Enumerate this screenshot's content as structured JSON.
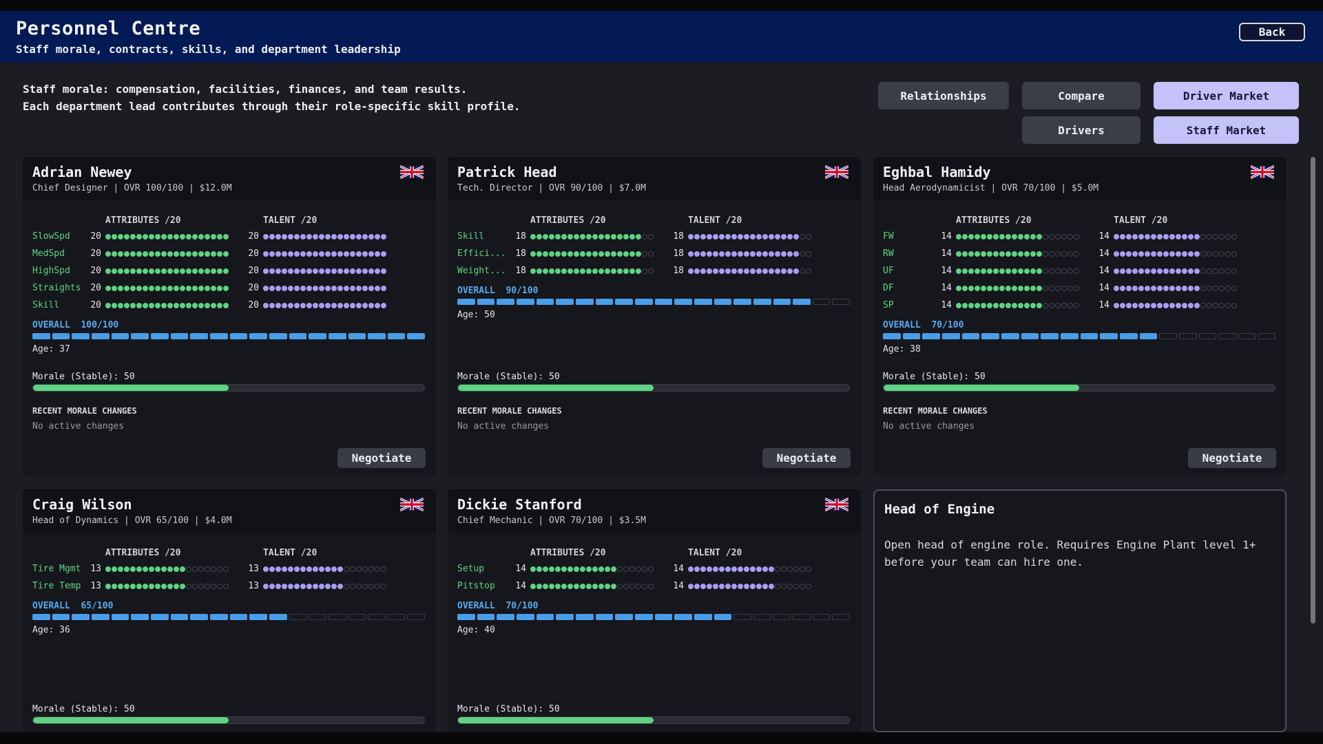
{
  "header": {
    "title": "Personnel Centre",
    "subtitle": "Staff morale, contracts, skills, and department leadership",
    "back_label": "Back"
  },
  "intro": {
    "line1": "Staff morale: compensation, facilities, finances, and team results.",
    "line2": "Each department lead contributes through their role-specific skill profile."
  },
  "nav": {
    "relationships": "Relationships",
    "compare": "Compare",
    "driver_market": "Driver Market",
    "drivers": "Drivers",
    "staff_market": "Staff Market"
  },
  "labels": {
    "attributes": "ATTRIBUTES /20",
    "talent": "TALENT /20",
    "overall": "OVERALL",
    "recent": "RECENT MORALE CHANGES",
    "no_changes": "No active changes",
    "negotiate": "Negotiate"
  },
  "accent_colors": {
    "header": "#041a54",
    "attribute_pip": "#5fd283",
    "talent_pip": "#a79ef2",
    "overall_bar": "#4a9de8",
    "morale_bar": "#5fd283",
    "active_nav": "#c4c2f8"
  },
  "staff": [
    {
      "name": "Adrian Newey",
      "meta": "Chief Designer | OVR 100/100 | $12.0M",
      "flag": "uk-flag-icon",
      "stats": [
        {
          "label": "SlowSpd",
          "attr": 20,
          "talent": 20
        },
        {
          "label": "MedSpd",
          "attr": 20,
          "talent": 20
        },
        {
          "label": "HighSpd",
          "attr": 20,
          "talent": 20
        },
        {
          "label": "Straights",
          "attr": 20,
          "talent": 20
        },
        {
          "label": "Skill",
          "attr": 20,
          "talent": 20
        }
      ],
      "overall": "100/100",
      "overall_value": 100,
      "age": "Age: 37",
      "morale": "Morale (Stable): 50",
      "morale_value": 50
    },
    {
      "name": "Patrick Head",
      "meta": "Tech. Director | OVR 90/100 | $7.0M",
      "flag": "uk-flag-icon",
      "stats": [
        {
          "label": "Skill",
          "attr": 18,
          "talent": 18
        },
        {
          "label": "Effici...",
          "attr": 18,
          "talent": 18
        },
        {
          "label": "Weight...",
          "attr": 18,
          "talent": 18
        }
      ],
      "overall": "90/100",
      "overall_value": 90,
      "age": "Age: 50",
      "morale": "Morale (Stable): 50",
      "morale_value": 50
    },
    {
      "name": "Eghbal Hamidy",
      "meta": "Head Aerodynamicist | OVR 70/100 | $5.0M",
      "flag": "uk-flag-icon",
      "stats": [
        {
          "label": "FW",
          "attr": 14,
          "talent": 14
        },
        {
          "label": "RW",
          "attr": 14,
          "talent": 14
        },
        {
          "label": "UF",
          "attr": 14,
          "talent": 14
        },
        {
          "label": "DF",
          "attr": 14,
          "talent": 14
        },
        {
          "label": "SP",
          "attr": 14,
          "talent": 14
        }
      ],
      "overall": "70/100",
      "overall_value": 70,
      "age": "Age: 38",
      "morale": "Morale (Stable): 50",
      "morale_value": 50
    },
    {
      "name": "Craig Wilson",
      "meta": "Head of Dynamics | OVR 65/100 | $4.0M",
      "flag": "uk-flag-icon",
      "stats": [
        {
          "label": "Tire Mgmt",
          "attr": 13,
          "talent": 13
        },
        {
          "label": "Tire Temp",
          "attr": 13,
          "talent": 13
        }
      ],
      "overall": "65/100",
      "overall_value": 65,
      "age": "Age: 36",
      "morale": "Morale (Stable): 50",
      "morale_value": 50
    },
    {
      "name": "Dickie Stanford",
      "meta": "Chief Mechanic | OVR 70/100 | $3.5M",
      "flag": "uk-flag-icon",
      "stats": [
        {
          "label": "Setup",
          "attr": 14,
          "talent": 14
        },
        {
          "label": "Pitstop",
          "attr": 14,
          "talent": 14
        }
      ],
      "overall": "70/100",
      "overall_value": 70,
      "age": "Age: 40",
      "morale": "Morale (Stable): 50",
      "morale_value": 50
    }
  ],
  "vacancy": {
    "title": "Head of Engine",
    "text": "Open head of engine role. Requires Engine Plant level 1+ before your team can hire one."
  }
}
